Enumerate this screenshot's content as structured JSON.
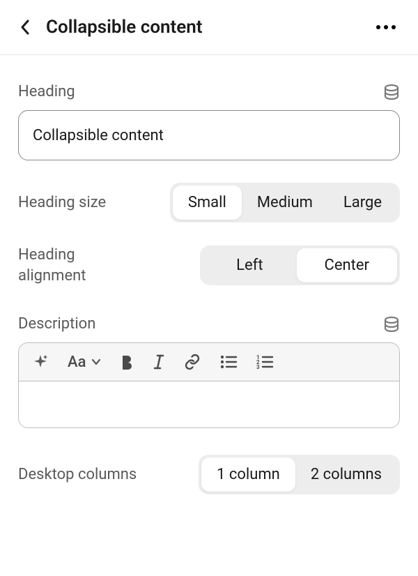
{
  "header": {
    "title": "Collapsible content"
  },
  "heading": {
    "label": "Heading",
    "value": "Collapsible content"
  },
  "heading_size": {
    "label": "Heading size",
    "options": [
      "Small",
      "Medium",
      "Large"
    ],
    "selected": "Small"
  },
  "heading_alignment": {
    "label": "Heading alignment",
    "options": [
      "Left",
      "Center"
    ],
    "selected": "Center"
  },
  "description": {
    "label": "Description",
    "value": "",
    "font_button": "Aa"
  },
  "desktop_columns": {
    "label": "Desktop columns",
    "options": [
      "1 column",
      "2 columns"
    ],
    "selected": "1 column"
  }
}
